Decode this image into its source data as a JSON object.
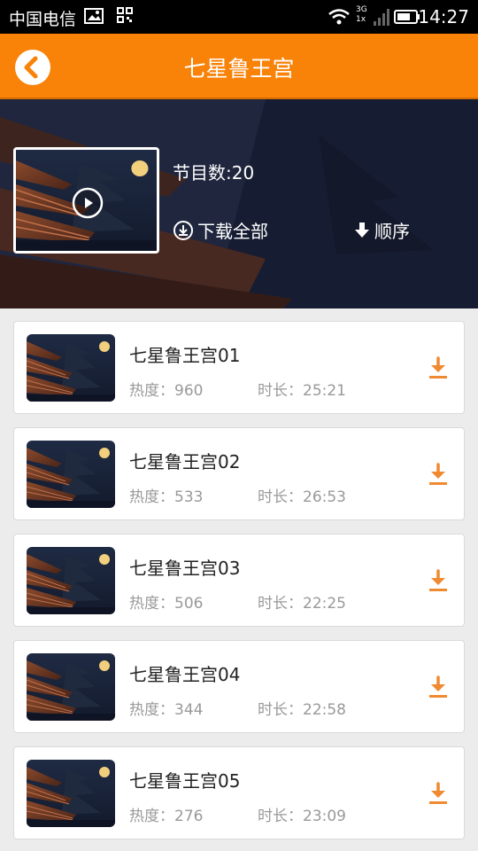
{
  "status_bar": {
    "carrier": "中国电信",
    "network": "3G",
    "network_sub": "1x",
    "time": "14:27"
  },
  "header": {
    "title": "七星鲁王宫",
    "back_icon": "chevron-left-icon",
    "background_color": "#f98208"
  },
  "album": {
    "episode_count": "节目数:20",
    "download_all_label": "下载全部",
    "sort_label": "顺序"
  },
  "episodes": [
    {
      "title": "七星鲁王宫01",
      "heat": "热度：960",
      "duration": "时长：25:21"
    },
    {
      "title": "七星鲁王宫02",
      "heat": "热度：533",
      "duration": "时长：26:53"
    },
    {
      "title": "七星鲁王宫03",
      "heat": "热度：506",
      "duration": "时长：22:25"
    },
    {
      "title": "七星鲁王宫04",
      "heat": "热度：344",
      "duration": "时长：22:58"
    },
    {
      "title": "七星鲁王宫05",
      "heat": "热度：276",
      "duration": "时长：23:09"
    }
  ],
  "colors": {
    "accent": "#f98208",
    "download_icon": "#f08a30"
  }
}
